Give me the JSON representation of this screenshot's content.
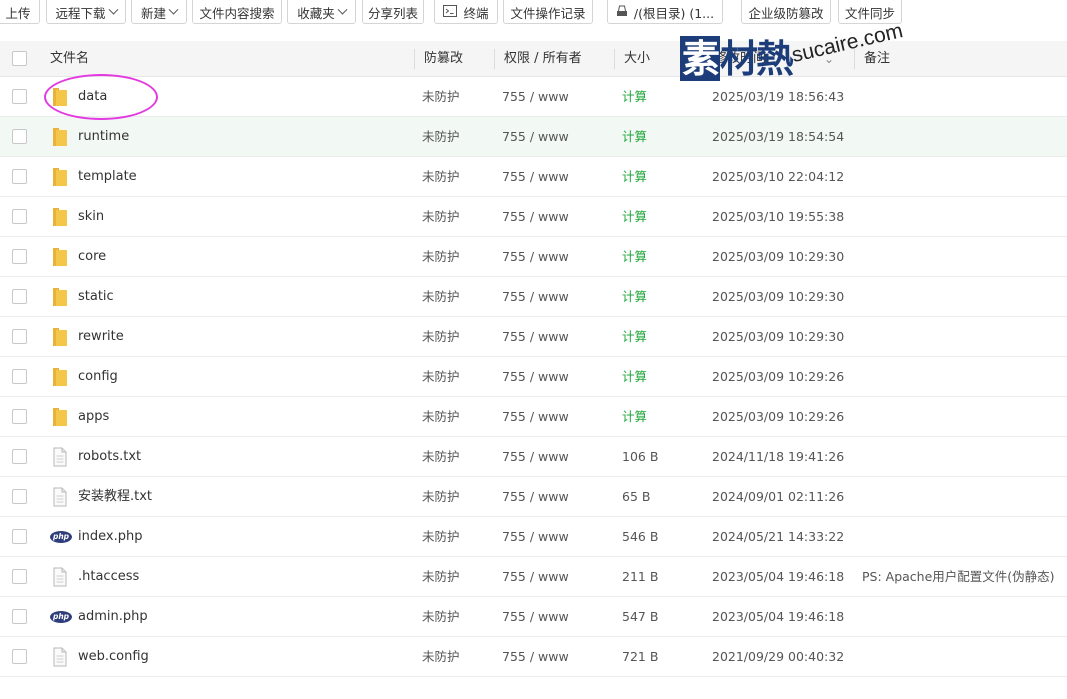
{
  "toolbar": {
    "upload": "上传",
    "remote_download": "远程下载",
    "new": "新建",
    "content_search": "文件内容搜索",
    "favorites": "收藏夹",
    "share_list": "分享列表",
    "terminal": "终端",
    "op_log": "文件操作记录",
    "path": "/(根目录) (1...",
    "tamper_proof": "企业级防篡改",
    "file_sync": "文件同步"
  },
  "header": {
    "filename": "文件名",
    "tamper": "防篡改",
    "perm_owner": "权限 / 所有者",
    "size": "大小",
    "modified": "修改时间",
    "note": "备注"
  },
  "watermark": {
    "cn": "素材熱",
    "en": "sucaire.com"
  },
  "rows": [
    {
      "name": "data",
      "type": "folder",
      "protect": "未防护",
      "perm": "755 / www",
      "size": "计算",
      "calc": true,
      "time": "2025/03/19 18:56:43",
      "note": ""
    },
    {
      "name": "runtime",
      "type": "folder",
      "protect": "未防护",
      "perm": "755 / www",
      "size": "计算",
      "calc": true,
      "time": "2025/03/19 18:54:54",
      "note": ""
    },
    {
      "name": "template",
      "type": "folder",
      "protect": "未防护",
      "perm": "755 / www",
      "size": "计算",
      "calc": true,
      "time": "2025/03/10 22:04:12",
      "note": ""
    },
    {
      "name": "skin",
      "type": "folder",
      "protect": "未防护",
      "perm": "755 / www",
      "size": "计算",
      "calc": true,
      "time": "2025/03/10 19:55:38",
      "note": ""
    },
    {
      "name": "core",
      "type": "folder",
      "protect": "未防护",
      "perm": "755 / www",
      "size": "计算",
      "calc": true,
      "time": "2025/03/09 10:29:30",
      "note": ""
    },
    {
      "name": "static",
      "type": "folder",
      "protect": "未防护",
      "perm": "755 / www",
      "size": "计算",
      "calc": true,
      "time": "2025/03/09 10:29:30",
      "note": ""
    },
    {
      "name": "rewrite",
      "type": "folder",
      "protect": "未防护",
      "perm": "755 / www",
      "size": "计算",
      "calc": true,
      "time": "2025/03/09 10:29:30",
      "note": ""
    },
    {
      "name": "config",
      "type": "folder",
      "protect": "未防护",
      "perm": "755 / www",
      "size": "计算",
      "calc": true,
      "time": "2025/03/09 10:29:26",
      "note": ""
    },
    {
      "name": "apps",
      "type": "folder",
      "protect": "未防护",
      "perm": "755 / www",
      "size": "计算",
      "calc": true,
      "time": "2025/03/09 10:29:26",
      "note": ""
    },
    {
      "name": "robots.txt",
      "type": "file",
      "protect": "未防护",
      "perm": "755 / www",
      "size": "106 B",
      "calc": false,
      "time": "2024/11/18 19:41:26",
      "note": ""
    },
    {
      "name": "安装教程.txt",
      "type": "file",
      "protect": "未防护",
      "perm": "755 / www",
      "size": "65 B",
      "calc": false,
      "time": "2024/09/01 02:11:26",
      "note": ""
    },
    {
      "name": "index.php",
      "type": "php",
      "protect": "未防护",
      "perm": "755 / www",
      "size": "546 B",
      "calc": false,
      "time": "2024/05/21 14:33:22",
      "note": ""
    },
    {
      "name": ".htaccess",
      "type": "file",
      "protect": "未防护",
      "perm": "755 / www",
      "size": "211 B",
      "calc": false,
      "time": "2023/05/04 19:46:18",
      "note": "PS: Apache用户配置文件(伪静态)"
    },
    {
      "name": "admin.php",
      "type": "php",
      "protect": "未防护",
      "perm": "755 / www",
      "size": "547 B",
      "calc": false,
      "time": "2023/05/04 19:46:18",
      "note": ""
    },
    {
      "name": "web.config",
      "type": "file",
      "protect": "未防护",
      "perm": "755 / www",
      "size": "721 B",
      "calc": false,
      "time": "2021/09/29 00:40:32",
      "note": ""
    }
  ],
  "colors": {
    "calc": "#20a53a",
    "folder": "#f4c64a",
    "highlight": "#e23ae0",
    "row_hover": "#f2f9f5"
  },
  "php_label": "php"
}
